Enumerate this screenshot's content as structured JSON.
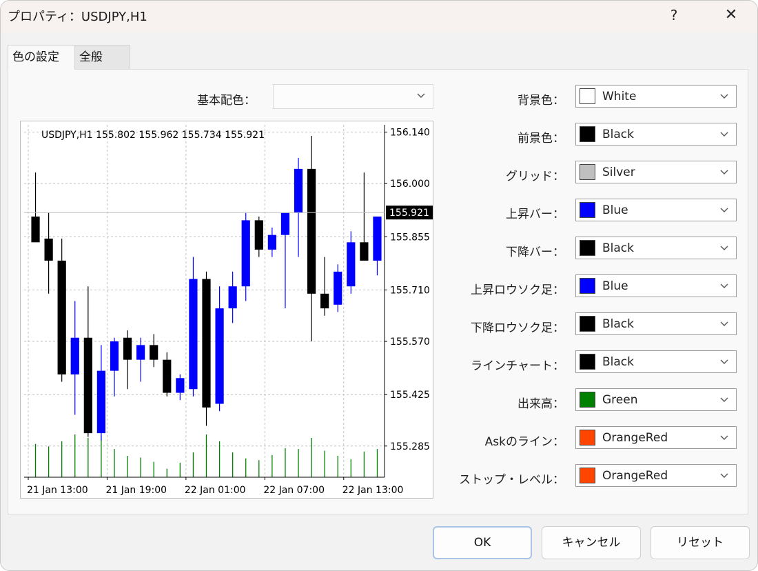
{
  "window": {
    "title": "プロパティ：USDJPY,H1",
    "help_label": "?",
    "close_label": "✕"
  },
  "tabs": [
    {
      "label": "色の設定",
      "active": true
    },
    {
      "label": "全般",
      "active": false
    }
  ],
  "scheme": {
    "label": "基本配色：",
    "value": ""
  },
  "chart": {
    "header": "USDJPY,H1  155.802 155.962 155.734 155.921",
    "price_labels": [
      "156.140",
      "156.000",
      "155.855",
      "155.710",
      "155.570",
      "155.425",
      "155.285"
    ],
    "current_price": "155.921",
    "time_labels": [
      "21 Jan 13:00",
      "21 Jan 19:00",
      "22 Jan 01:00",
      "22 Jan 07:00",
      "22 Jan 13:00"
    ]
  },
  "chart_data": {
    "type": "candlestick",
    "symbol": "USDJPY",
    "timeframe": "H1",
    "ohlc_header": {
      "open": 155.802,
      "high": 155.962,
      "low": 155.734,
      "close": 155.921
    },
    "ylim": [
      155.2,
      156.16
    ],
    "yticks": [
      156.14,
      156.0,
      155.855,
      155.71,
      155.57,
      155.425,
      155.285
    ],
    "xticks": [
      "21 Jan 13:00",
      "21 Jan 19:00",
      "22 Jan 01:00",
      "22 Jan 07:00",
      "22 Jan 13:00"
    ],
    "candles": [
      {
        "o": 155.91,
        "h": 156.03,
        "l": 155.87,
        "c": 155.84,
        "up": false
      },
      {
        "o": 155.85,
        "h": 155.92,
        "l": 155.7,
        "c": 155.79,
        "up": false
      },
      {
        "o": 155.79,
        "h": 155.85,
        "l": 155.46,
        "c": 155.48,
        "up": false
      },
      {
        "o": 155.48,
        "h": 155.68,
        "l": 155.37,
        "c": 155.58,
        "up": true
      },
      {
        "o": 155.58,
        "h": 155.72,
        "l": 155.31,
        "c": 155.32,
        "up": false
      },
      {
        "o": 155.32,
        "h": 155.56,
        "l": 155.3,
        "c": 155.49,
        "up": true
      },
      {
        "o": 155.49,
        "h": 155.58,
        "l": 155.42,
        "c": 155.57,
        "up": true
      },
      {
        "o": 155.58,
        "h": 155.6,
        "l": 155.44,
        "c": 155.52,
        "up": false
      },
      {
        "o": 155.52,
        "h": 155.58,
        "l": 155.46,
        "c": 155.56,
        "up": true
      },
      {
        "o": 155.56,
        "h": 155.59,
        "l": 155.5,
        "c": 155.52,
        "up": false
      },
      {
        "o": 155.52,
        "h": 155.54,
        "l": 155.42,
        "c": 155.43,
        "up": false
      },
      {
        "o": 155.43,
        "h": 155.48,
        "l": 155.41,
        "c": 155.47,
        "up": true
      },
      {
        "o": 155.44,
        "h": 155.8,
        "l": 155.42,
        "c": 155.74,
        "up": true
      },
      {
        "o": 155.74,
        "h": 155.76,
        "l": 155.34,
        "c": 155.39,
        "up": false
      },
      {
        "o": 155.4,
        "h": 155.72,
        "l": 155.38,
        "c": 155.66,
        "up": true
      },
      {
        "o": 155.66,
        "h": 155.76,
        "l": 155.62,
        "c": 155.72,
        "up": true
      },
      {
        "o": 155.72,
        "h": 155.92,
        "l": 155.68,
        "c": 155.9,
        "up": true
      },
      {
        "o": 155.9,
        "h": 155.91,
        "l": 155.8,
        "c": 155.82,
        "up": false
      },
      {
        "o": 155.82,
        "h": 155.88,
        "l": 155.8,
        "c": 155.86,
        "up": true
      },
      {
        "o": 155.86,
        "h": 155.9,
        "l": 155.66,
        "c": 155.92,
        "up": true
      },
      {
        "o": 155.92,
        "h": 156.07,
        "l": 155.8,
        "c": 156.04,
        "up": true
      },
      {
        "o": 156.04,
        "h": 156.13,
        "l": 155.57,
        "c": 155.7,
        "up": false
      },
      {
        "o": 155.7,
        "h": 155.8,
        "l": 155.64,
        "c": 155.66,
        "up": false
      },
      {
        "o": 155.67,
        "h": 155.78,
        "l": 155.65,
        "c": 155.76,
        "up": true
      },
      {
        "o": 155.72,
        "h": 155.87,
        "l": 155.7,
        "c": 155.84,
        "up": true
      },
      {
        "o": 155.84,
        "h": 156.03,
        "l": 155.82,
        "c": 155.79,
        "up": false
      },
      {
        "o": 155.79,
        "h": 155.9,
        "l": 155.75,
        "c": 155.91,
        "up": true
      }
    ],
    "volume_relative": [
      0.78,
      0.72,
      0.84,
      1.0,
      0.92,
      1.0,
      0.66,
      0.5,
      0.46,
      0.36,
      0.2,
      0.34,
      0.58,
      1.0,
      0.84,
      0.58,
      0.44,
      0.4,
      0.52,
      0.68,
      0.66,
      0.92,
      0.62,
      0.5,
      0.42,
      0.6,
      0.66
    ],
    "colors": {
      "up": "#0000ff",
      "down": "#000000",
      "grid": "#c0c0c0",
      "volume": "#008000"
    }
  },
  "color_settings": [
    {
      "label": "背景色：",
      "name": "White",
      "hex": "#ffffff"
    },
    {
      "label": "前景色：",
      "name": "Black",
      "hex": "#000000"
    },
    {
      "label": "グリッド：",
      "name": "Silver",
      "hex": "#c0c0c0"
    },
    {
      "label": "上昇バー：",
      "name": "Blue",
      "hex": "#0000ff"
    },
    {
      "label": "下降バー：",
      "name": "Black",
      "hex": "#000000"
    },
    {
      "label": "上昇ロウソク足：",
      "name": "Blue",
      "hex": "#0000ff"
    },
    {
      "label": "下降ロウソク足：",
      "name": "Black",
      "hex": "#000000"
    },
    {
      "label": "ラインチャート：",
      "name": "Black",
      "hex": "#000000"
    },
    {
      "label": "出来高：",
      "name": "Green",
      "hex": "#008000"
    },
    {
      "label": "Askのライン：",
      "name": "OrangeRed",
      "hex": "#ff4500"
    },
    {
      "label": "ストップ・レベル：",
      "name": "OrangeRed",
      "hex": "#ff4500"
    }
  ],
  "buttons": {
    "ok": "OK",
    "cancel": "キャンセル",
    "reset": "リセット"
  }
}
